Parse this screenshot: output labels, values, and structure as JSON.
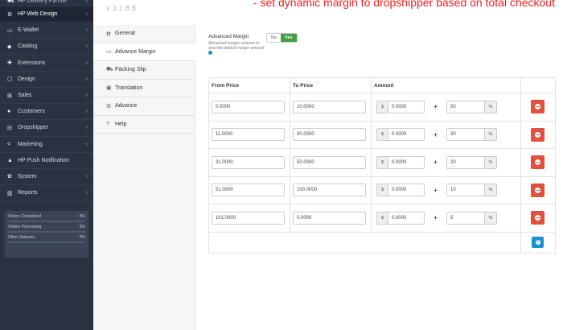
{
  "sidebar": {
    "items": [
      {
        "icon": "truck-icon",
        "glyph": "⛟",
        "label": "HP Delivery Partner",
        "active": false,
        "top": true
      },
      {
        "icon": "cogs-icon",
        "glyph": "⚙",
        "label": "HP Web Design",
        "active": true
      },
      {
        "icon": "wallet-icon",
        "glyph": "▭",
        "label": "E-Wallet",
        "active": false
      },
      {
        "icon": "tag-icon",
        "glyph": "◆",
        "label": "Catalog",
        "active": false
      },
      {
        "icon": "puzzle-icon",
        "glyph": "✚",
        "label": "Extensions",
        "active": false
      },
      {
        "icon": "desktop-icon",
        "glyph": "▢",
        "label": "Design",
        "active": false
      },
      {
        "icon": "cart-icon",
        "glyph": "⊞",
        "label": "Sales",
        "active": false
      },
      {
        "icon": "user-icon",
        "glyph": "●",
        "label": "Customers",
        "active": false
      },
      {
        "icon": "sitemap-icon",
        "glyph": "⊟",
        "label": "Dropshipper",
        "active": false
      },
      {
        "icon": "share-icon",
        "glyph": "<",
        "label": "Marketing",
        "active": false
      },
      {
        "icon": "bell-icon",
        "glyph": "▲",
        "label": "HP Push Notification",
        "active": false,
        "nochev": true
      },
      {
        "icon": "cog-icon",
        "glyph": "✿",
        "label": "System",
        "active": false
      },
      {
        "icon": "bar-chart-icon",
        "glyph": "▥",
        "label": "Reports",
        "active": false
      }
    ],
    "stats": [
      {
        "label": "Orders Completed",
        "value": "0%",
        "fill": 0
      },
      {
        "label": "Orders Processing",
        "value": "0%",
        "fill": 0
      },
      {
        "label": "Other Statuses",
        "value": "0%",
        "fill": 0
      }
    ]
  },
  "header": {
    "version": "v 3.1.8.8",
    "headline": "- set dynamic margin to dropshipper based on total checkout"
  },
  "tabs": [
    {
      "icon": "cog-icon",
      "glyph": "✿",
      "label": "General",
      "active": false
    },
    {
      "icon": "credit-card-icon",
      "glyph": "▭",
      "label": "Advance Margin",
      "active": true
    },
    {
      "icon": "truck-icon",
      "glyph": "⛟",
      "label": "Packing Slip",
      "active": false
    },
    {
      "icon": "language-icon",
      "glyph": "▣",
      "label": "Translation",
      "active": false
    },
    {
      "icon": "cogs-icon",
      "glyph": "⚙",
      "label": "Advance",
      "active": false
    },
    {
      "icon": "question-icon",
      "glyph": "?",
      "label": "Help",
      "active": false
    }
  ],
  "advanced": {
    "label": "Advanced Margin",
    "help": "Advanced margin scheme to override default margin amount",
    "off_label": "No",
    "on_label": "Yes"
  },
  "table": {
    "headers": [
      "From Price",
      "To Price",
      "Amount"
    ],
    "currency": "$",
    "plus": "+",
    "percent": "%",
    "rows": [
      {
        "from": "0.0000",
        "to": "10.0000",
        "amount": "0.0000",
        "percent": "50"
      },
      {
        "from": "11.0000",
        "to": "30.0000",
        "amount": "0.0000",
        "percent": "30"
      },
      {
        "from": "31.0000",
        "to": "50.0000",
        "amount": "0.0000",
        "percent": "20"
      },
      {
        "from": "51.0000",
        "to": "100.0000",
        "amount": "0.0000",
        "percent": "10"
      },
      {
        "from": "101.0000",
        "to": "0.0000",
        "amount": "0.0000",
        "percent": "5"
      }
    ]
  },
  "colors": {
    "sidebar": "#2a3342",
    "accent_green": "#44a047",
    "danger": "#e3503e",
    "primary": "#1e91cf",
    "headline": "#f01e1e"
  }
}
